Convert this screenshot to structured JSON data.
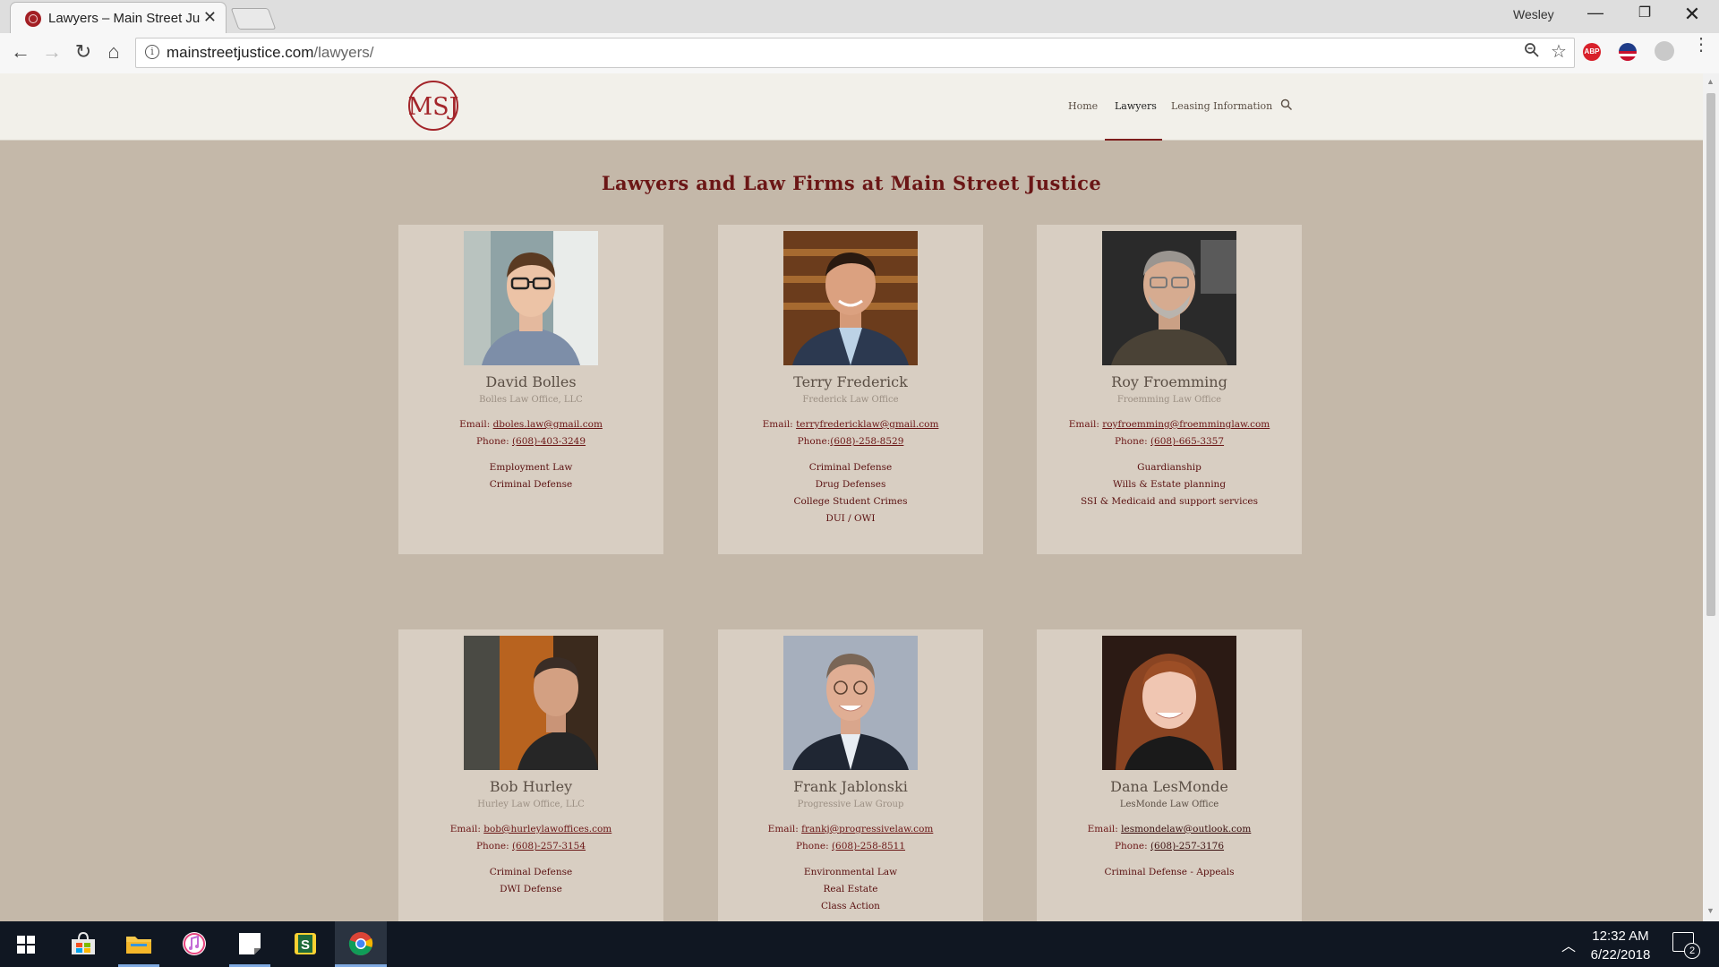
{
  "browser": {
    "tab_title": "Lawyers – Main Street Jus",
    "tab_close": "✕",
    "profile_name": "Wesley",
    "url_host": "mainstreetjustice.com",
    "url_path": "/lawyers/",
    "min_glyph": "—",
    "max_glyph": "❐",
    "close_glyph": "✕",
    "back_glyph": "←",
    "forward_glyph": "→",
    "reload_glyph": "↻",
    "home_glyph": "⌂",
    "abp_label": "ABP",
    "info_glyph": "i"
  },
  "site": {
    "logo_text": "MSJ",
    "nav": [
      {
        "label": "Home"
      },
      {
        "label": "Lawyers",
        "active": true
      },
      {
        "label": "Leasing Information"
      }
    ],
    "page_title": "Lawyers and Law Firms at Main Street Justice"
  },
  "lawyers": [
    {
      "name": "David Bolles",
      "firm": "Bolles Law Office, LLC",
      "email_label": "Email:",
      "email": "dboles.law@gmail.com",
      "phone_label": "Phone:",
      "phone": "(608)-403-3249",
      "practice": [
        "Employment Law",
        "Criminal Defense"
      ]
    },
    {
      "name": "Terry Frederick",
      "firm": "Frederick Law Office",
      "email_label": "Email:",
      "email": "terryfredericklaw@gmail.com",
      "phone_label": "Phone:",
      "phone": "(608)-258-8529",
      "practice": [
        "Criminal Defense",
        "Drug Defenses",
        "College Student Crimes",
        "DUI / OWI"
      ]
    },
    {
      "name": "Roy Froemming",
      "firm": "Froemming Law Office",
      "email_label": "Email:",
      "email": "royfroemming@froemminglaw.com",
      "phone_label": "Phone:",
      "phone": "(608)-665-3357",
      "practice": [
        "Guardianship",
        "Wills & Estate planning",
        "SSI & Medicaid and support services"
      ]
    },
    {
      "name": "Bob Hurley",
      "firm": "Hurley Law Office, LLC",
      "email_label": "Email:",
      "email": "bob@hurleylawoffices.com",
      "phone_label": "Phone:",
      "phone": "(608)-257-3154",
      "practice": [
        "Criminal Defense",
        "DWI Defense"
      ]
    },
    {
      "name": "Frank Jablonski",
      "firm": "Progressive Law Group",
      "email_label": "Email:",
      "email": "frankj@progressivelaw.com",
      "phone_label": "Phone:",
      "phone": "(608)-258-8511",
      "practice": [
        "Environmental Law",
        "Real Estate",
        "Class Action"
      ]
    },
    {
      "name": "Dana LesMonde",
      "firm": "LesMonde Law Office",
      "email_label": "Email:",
      "email": "lesmondelaw@outlook.com",
      "phone_label": "Phone:",
      "phone": "(608)-257-3176",
      "practice": [
        "Criminal Defense - Appeals"
      ]
    }
  ],
  "taskbar": {
    "time": "12:32 AM",
    "date": "6/22/2018",
    "notification_count": "2"
  }
}
